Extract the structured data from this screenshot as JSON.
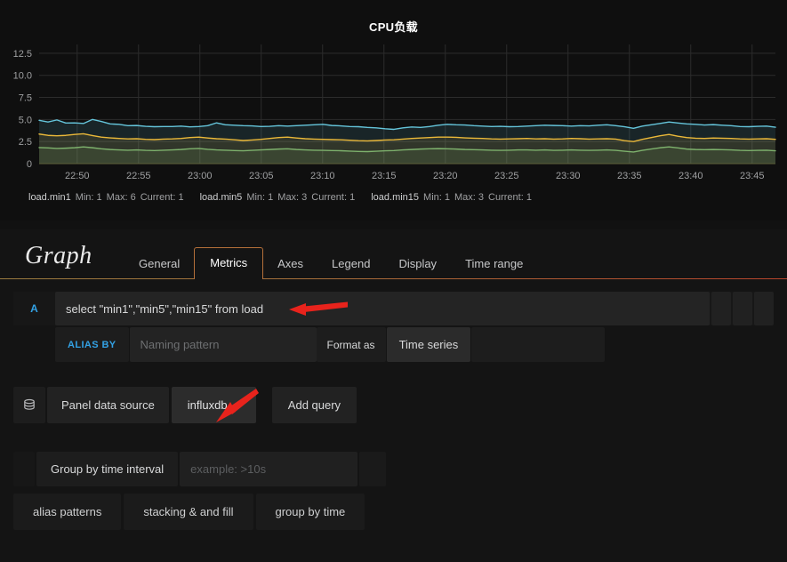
{
  "panel": {
    "title": "CPU负载",
    "legend": [
      {
        "name": "load.min1",
        "min": "Min: 1",
        "max": "Max: 6",
        "current": "Current: 1",
        "color": "#65c5db"
      },
      {
        "name": "load.min5",
        "min": "Min: 1",
        "max": "Max: 3",
        "current": "Current: 1",
        "color": "#eab839"
      },
      {
        "name": "load.min15",
        "min": "Min: 1",
        "max": "Max: 3",
        "current": "Current: 1",
        "color": "#7eb26d"
      }
    ]
  },
  "chart_data": {
    "type": "line",
    "title": "CPU负载",
    "xlabel": "",
    "ylabel": "",
    "ylim": [
      0,
      13.5
    ],
    "yticks": [
      "0",
      "2.5",
      "5.0",
      "7.5",
      "10.0",
      "12.5"
    ],
    "ytick_values": [
      0,
      2.5,
      5.0,
      7.5,
      10.0,
      12.5
    ],
    "xticks": [
      "22:50",
      "22:55",
      "23:00",
      "23:05",
      "23:10",
      "23:15",
      "23:20",
      "23:25",
      "23:30",
      "23:35",
      "23:40",
      "23:45"
    ],
    "grid": true,
    "legend_position": "bottom",
    "series": [
      {
        "name": "load.min1",
        "color": "#65c5db",
        "values": [
          4.9,
          4.72,
          4.95,
          4.6,
          4.62,
          4.55,
          5.0,
          4.78,
          4.5,
          4.45,
          4.3,
          4.32,
          4.22,
          4.18,
          4.2,
          4.2,
          4.25,
          4.16,
          4.2,
          4.3,
          4.62,
          4.4,
          4.35,
          4.3,
          4.28,
          4.2,
          4.22,
          4.3,
          4.25,
          4.3,
          4.35,
          4.4,
          4.45,
          4.32,
          4.28,
          4.2,
          4.18,
          4.1,
          4.05,
          3.95,
          3.88,
          4.05,
          4.15,
          4.1,
          4.2,
          4.35,
          4.45,
          4.4,
          4.38,
          4.3,
          4.25,
          4.2,
          4.22,
          4.18,
          4.2,
          4.25,
          4.3,
          4.35,
          4.32,
          4.3,
          4.25,
          4.3,
          4.28,
          4.35,
          4.4,
          4.3,
          4.18,
          4.0,
          4.25,
          4.4,
          4.55,
          4.72,
          4.6,
          4.5,
          4.45,
          4.38,
          4.42,
          4.35,
          4.3,
          4.2,
          4.18,
          4.22,
          4.25,
          4.12
        ]
      },
      {
        "name": "load.min5",
        "color": "#eab839",
        "values": [
          3.35,
          3.2,
          3.15,
          3.2,
          3.3,
          3.38,
          3.18,
          3.0,
          2.92,
          2.85,
          2.8,
          2.82,
          2.75,
          2.72,
          2.78,
          2.8,
          2.85,
          2.95,
          3.0,
          2.9,
          2.82,
          2.78,
          2.7,
          2.62,
          2.68,
          2.75,
          2.85,
          2.95,
          3.0,
          2.9,
          2.82,
          2.78,
          2.75,
          2.72,
          2.7,
          2.65,
          2.6,
          2.58,
          2.62,
          2.68,
          2.7,
          2.78,
          2.85,
          2.9,
          2.95,
          3.0,
          3.0,
          2.98,
          2.92,
          2.88,
          2.85,
          2.8,
          2.78,
          2.8,
          2.82,
          2.85,
          2.8,
          2.82,
          2.78,
          2.8,
          2.85,
          2.82,
          2.78,
          2.8,
          2.82,
          2.78,
          2.6,
          2.5,
          2.75,
          2.95,
          3.15,
          3.3,
          3.1,
          2.95,
          2.88,
          2.85,
          2.9,
          2.88,
          2.85,
          2.8,
          2.78,
          2.8,
          2.82,
          2.75
        ]
      },
      {
        "name": "load.min15",
        "color": "#7eb26d",
        "values": [
          1.82,
          1.78,
          1.72,
          1.75,
          1.8,
          1.9,
          1.8,
          1.68,
          1.6,
          1.55,
          1.52,
          1.55,
          1.5,
          1.48,
          1.52,
          1.55,
          1.6,
          1.68,
          1.72,
          1.62,
          1.55,
          1.52,
          1.48,
          1.45,
          1.5,
          1.55,
          1.6,
          1.65,
          1.68,
          1.6,
          1.55,
          1.52,
          1.5,
          1.48,
          1.46,
          1.42,
          1.38,
          1.36,
          1.4,
          1.45,
          1.48,
          1.55,
          1.6,
          1.65,
          1.68,
          1.7,
          1.68,
          1.65,
          1.6,
          1.58,
          1.55,
          1.52,
          1.5,
          1.52,
          1.55,
          1.55,
          1.52,
          1.55,
          1.5,
          1.52,
          1.55,
          1.52,
          1.5,
          1.52,
          1.55,
          1.5,
          1.4,
          1.32,
          1.5,
          1.65,
          1.8,
          1.9,
          1.78,
          1.65,
          1.6,
          1.58,
          1.6,
          1.58,
          1.55,
          1.5,
          1.48,
          1.5,
          1.52,
          1.45
        ]
      }
    ]
  },
  "editor": {
    "title": "Graph",
    "tabs": [
      {
        "label": "General",
        "active": false
      },
      {
        "label": "Metrics",
        "active": true
      },
      {
        "label": "Axes",
        "active": false
      },
      {
        "label": "Legend",
        "active": false
      },
      {
        "label": "Display",
        "active": false
      },
      {
        "label": "Time range",
        "active": false
      }
    ],
    "query": {
      "letter": "A",
      "text": "select \"min1\",\"min5\",\"min15\" from load",
      "alias_label": "ALIAS BY",
      "alias_value": "",
      "alias_placeholder": "Naming pattern",
      "format_as_label": "Format as",
      "format_as_value": "Time series"
    },
    "datasource": {
      "icon": "database-icon",
      "label": "Panel data source",
      "value": "influxdb",
      "add_query_label": "Add query"
    },
    "groupby": {
      "label": "Group by time interval",
      "value": "",
      "placeholder": "example: >10s"
    },
    "help_links": [
      {
        "label": "alias patterns"
      },
      {
        "label": "stacking & and fill"
      },
      {
        "label": "group by time"
      }
    ]
  },
  "annotations": {
    "arrow_color": "#e8231c",
    "arrow_query": "points-to-query-text",
    "arrow_datasource": "points-to-influxdb-select"
  }
}
